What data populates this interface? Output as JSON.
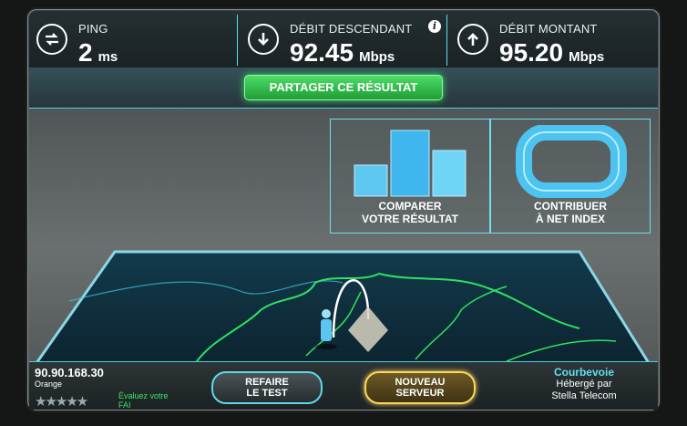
{
  "header": {
    "ping": {
      "label": "PING",
      "value": "2",
      "unit": "ms",
      "icon": "ping-arrows-icon"
    },
    "download": {
      "label": "DÉBIT DESCENDANT",
      "value": "92.45",
      "unit": "Mbps",
      "icon": "arrow-down-icon"
    },
    "upload": {
      "label": "DÉBIT MONTANT",
      "value": "95.20",
      "unit": "Mbps",
      "icon": "arrow-up-icon"
    },
    "info_glyph": "i"
  },
  "share": {
    "label": "PARTAGER CE RÉSULTAT"
  },
  "panels": {
    "compare": {
      "line1": "COMPARER",
      "line2": "VOTRE RÉSULTAT",
      "icon": "bar-chart-icon"
    },
    "contribute": {
      "line1": "CONTRIBUER",
      "line2": "À NET INDEX",
      "icon": "ring-icon"
    }
  },
  "footer": {
    "ip": "90.90.168.30",
    "isp": "Orange",
    "stars": "★★★★★",
    "rate_line1": "Évaluez votre",
    "rate_line2": "FAI",
    "retest_line1": "REFAIRE",
    "retest_line2": "LE TEST",
    "newserver_line1": "NOUVEAU",
    "newserver_line2": "SERVEUR",
    "server_city": "Courbevoie",
    "hosted_by": "Hébergé par",
    "host_name": "Stella Telecom"
  },
  "colors": {
    "accent": "#5ee0f0",
    "green": "#3ee466",
    "gold": "#ffd65a"
  }
}
